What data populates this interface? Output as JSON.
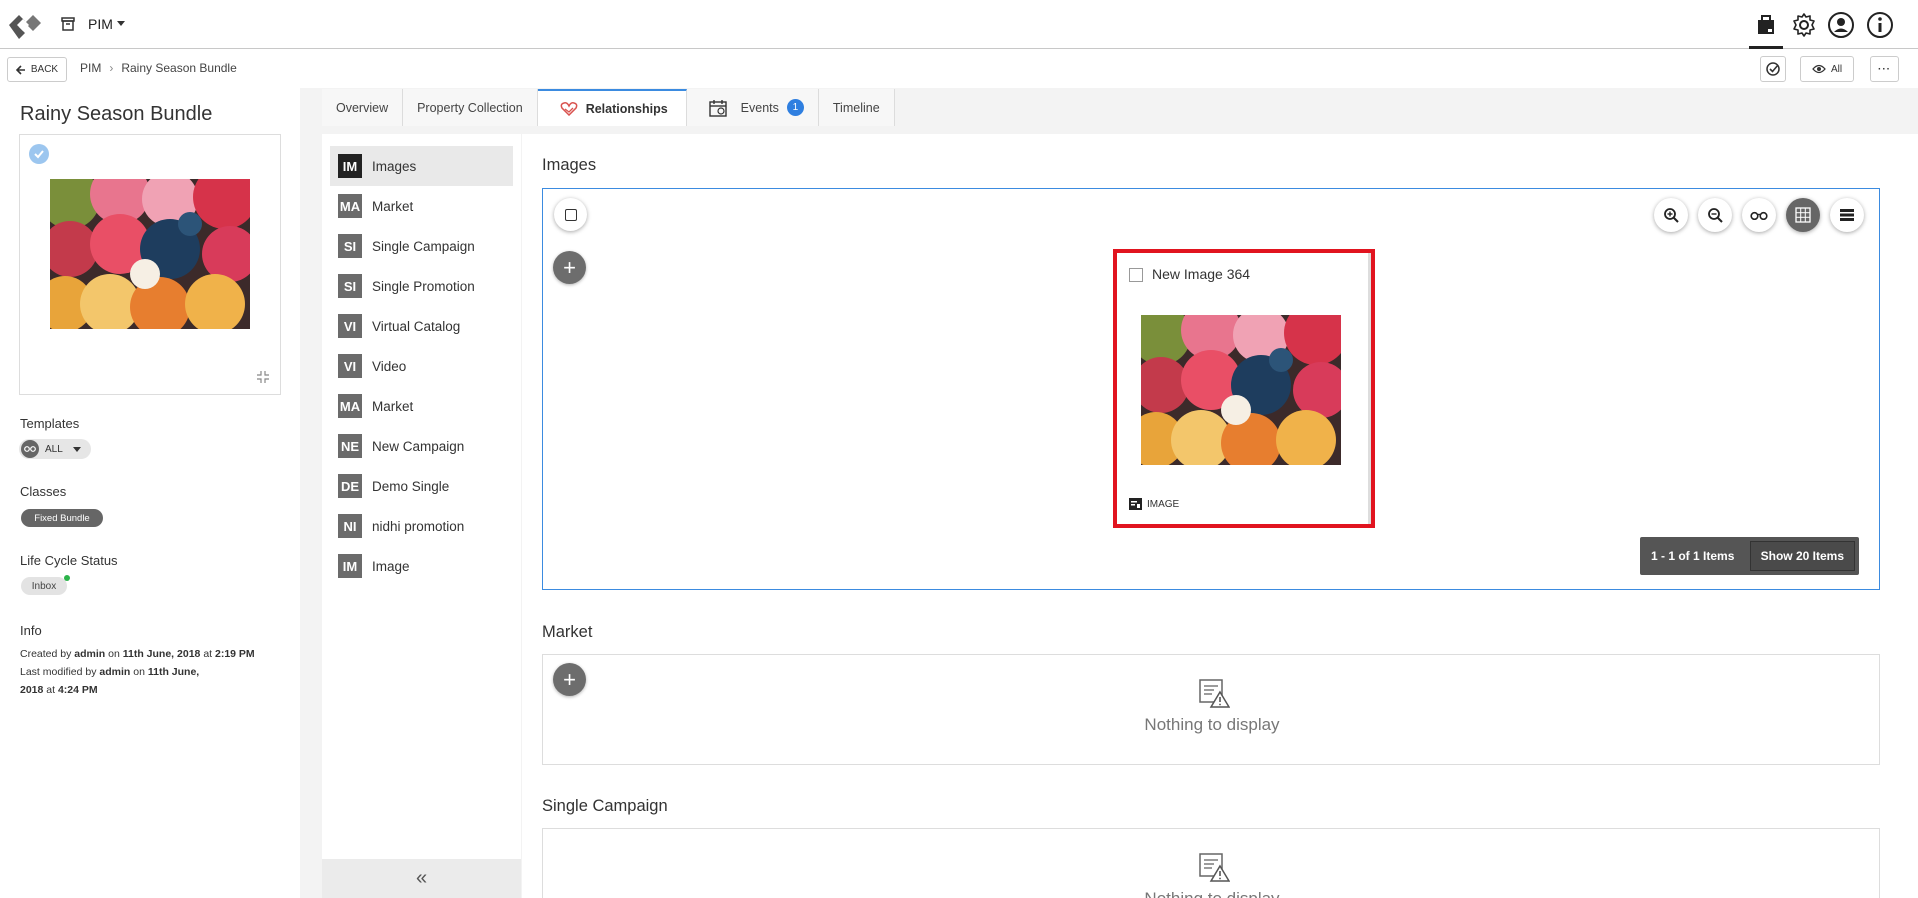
{
  "topbar": {
    "app_name": "PIM",
    "icons": [
      "logo-icon",
      "archive-icon",
      "bag-icon",
      "gear-icon",
      "user-icon",
      "info-icon"
    ]
  },
  "crumbbar": {
    "back_label": "BACK",
    "crumbs": [
      "PIM",
      "Rainy Season Bundle"
    ],
    "view_label": "All"
  },
  "product": {
    "title": "Rainy Season Bundle",
    "templates_label": "Templates",
    "templates_value": "ALL",
    "classes_label": "Classes",
    "class_value": "Fixed Bundle",
    "lifecycle_label": "Life Cycle Status",
    "lifecycle_value": "Inbox",
    "info_label": "Info",
    "info": {
      "created_prefix": "Created by",
      "created_by": "admin",
      "on1": "on",
      "created_date": "11th June, 2018",
      "at1": "at",
      "created_time": "2:19 PM",
      "modified_prefix": "Last modified by",
      "modified_by": "admin",
      "on2": "on",
      "modified_date_a": "11th June,",
      "modified_date_b": "2018",
      "at2": "at",
      "modified_time": "4:24 PM"
    }
  },
  "tabs": [
    {
      "label": "Overview"
    },
    {
      "label": "Property Collection"
    },
    {
      "label": "Relationships"
    },
    {
      "label": "Events",
      "badge": "1"
    },
    {
      "label": "Timeline"
    }
  ],
  "relationships": [
    {
      "abbr": "IM",
      "label": "Images"
    },
    {
      "abbr": "MA",
      "label": "Market"
    },
    {
      "abbr": "SI",
      "label": "Single Campaign"
    },
    {
      "abbr": "SI",
      "label": "Single Promotion"
    },
    {
      "abbr": "VI",
      "label": "Virtual Catalog"
    },
    {
      "abbr": "VI",
      "label": "Video"
    },
    {
      "abbr": "MA",
      "label": "Market"
    },
    {
      "abbr": "NE",
      "label": "New Campaign"
    },
    {
      "abbr": "DE",
      "label": "Demo Single"
    },
    {
      "abbr": "NI",
      "label": "nidhi promotion"
    },
    {
      "abbr": "IM",
      "label": "Image"
    }
  ],
  "sections": {
    "images_title": "Images",
    "card_name": "New Image 364",
    "card_type": "IMAGE",
    "pager_count": "1 - 1 of 1 Items",
    "pager_show": "Show 20 Items",
    "market_title": "Market",
    "empty_text": "Nothing to display",
    "campaign_title": "Single Campaign",
    "campaign_empty_partial": "Nothing to display"
  },
  "colors": {
    "accent": "#3b8be0",
    "highlight": "#e1141f",
    "badge": "#2f7fe0",
    "status_dot": "#2cb34a"
  }
}
